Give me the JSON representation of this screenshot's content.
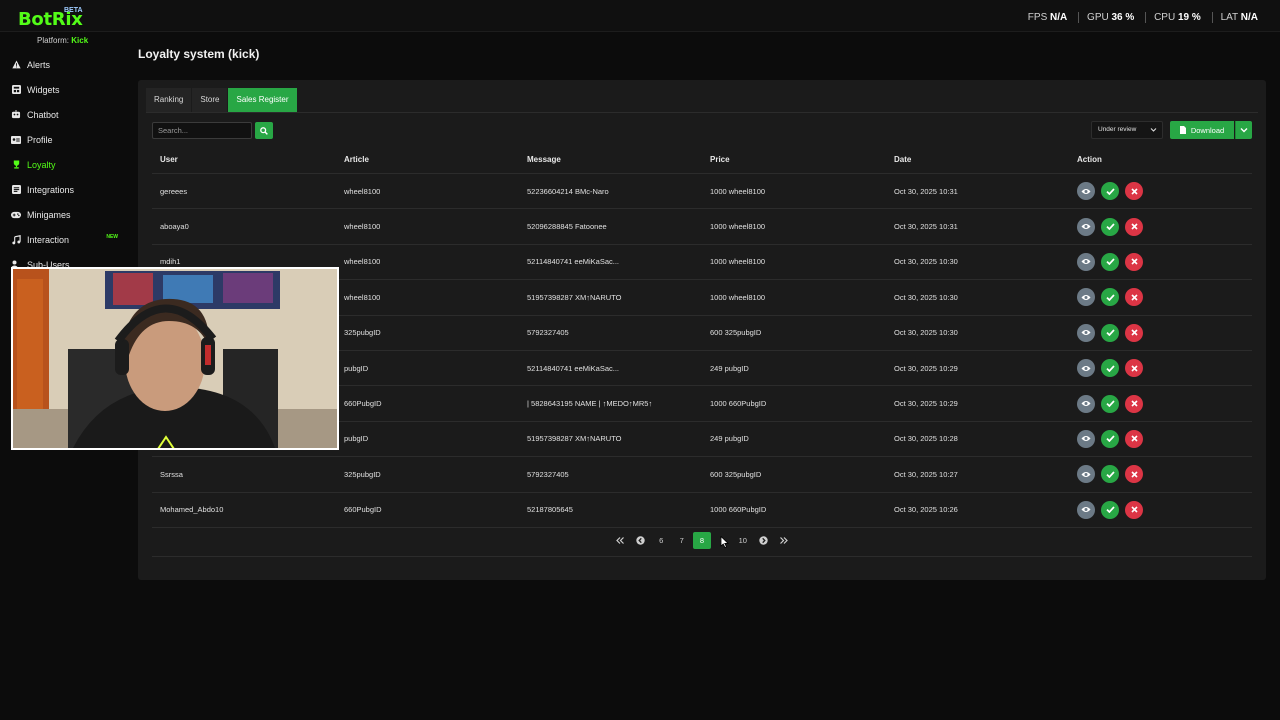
{
  "app": {
    "logo": "BotRix",
    "logo_badge": "BETA"
  },
  "stats": [
    {
      "label": "FPS",
      "value": "N/A"
    },
    {
      "label": "GPU",
      "value": "36 %"
    },
    {
      "label": "CPU",
      "value": "19 %"
    },
    {
      "label": "LAT",
      "value": "N/A"
    }
  ],
  "platform": {
    "label": "Platform:",
    "value": "Kick"
  },
  "sidebar": {
    "items": [
      {
        "label": "Alerts",
        "icon": "alert-triangle-icon"
      },
      {
        "label": "Widgets",
        "icon": "widgets-icon"
      },
      {
        "label": "Chatbot",
        "icon": "robot-icon"
      },
      {
        "label": "Profile",
        "icon": "id-card-icon"
      },
      {
        "label": "Loyalty",
        "icon": "trophy-icon",
        "active": true
      },
      {
        "label": "Integrations",
        "icon": "integrations-icon"
      },
      {
        "label": "Minigames",
        "icon": "gamepad-icon"
      },
      {
        "label": "Interaction",
        "icon": "music-icon",
        "badge": "NEW"
      },
      {
        "label": "Sub-Users",
        "icon": "users-icon"
      }
    ]
  },
  "page_title": "Loyalty system (kick)",
  "tabs": [
    {
      "label": "Ranking"
    },
    {
      "label": "Store"
    },
    {
      "label": "Sales Register",
      "active": true
    }
  ],
  "search": {
    "placeholder": "Search..."
  },
  "filter": {
    "selected": "Under review"
  },
  "download": {
    "label": "Download"
  },
  "table": {
    "columns": [
      "User",
      "Article",
      "Message",
      "Price",
      "Date",
      "Action"
    ],
    "rows": [
      {
        "user": "gereees",
        "article": "wheel8100",
        "message": "52236604214 BMc-Naro",
        "price": "1000 wheel8100",
        "date": "Oct 30, 2025 10:31"
      },
      {
        "user": "aboaya0",
        "article": "wheel8100",
        "message": "52096288845 Fatoonee",
        "price": "1000 wheel8100",
        "date": "Oct 30, 2025 10:31"
      },
      {
        "user": "mdih1",
        "article": "wheel8100",
        "message": "52114840741 eeMiKaSac...",
        "price": "1000 wheel8100",
        "date": "Oct 30, 2025 10:30"
      },
      {
        "user": "",
        "article": "wheel8100",
        "message": "51957398287 XM↑NARUTO",
        "price": "1000 wheel8100",
        "date": "Oct 30, 2025 10:30"
      },
      {
        "user": "",
        "article": "325pubgID",
        "message": "5792327405",
        "price": "600 325pubgID",
        "date": "Oct 30, 2025 10:30"
      },
      {
        "user": "",
        "article": "pubgID",
        "message": "52114840741 eeMiKaSac...",
        "price": "249 pubgID",
        "date": "Oct 30, 2025 10:29"
      },
      {
        "user": "",
        "article": "660PubgID",
        "message": "| 5828643195 NAME | ↑MEDO↑MR5↑",
        "price": "1000 660PubgID",
        "date": "Oct 30, 2025 10:29"
      },
      {
        "user": "",
        "article": "pubgID",
        "message": "51957398287 XM↑NARUTO",
        "price": "249 pubgID",
        "date": "Oct 30, 2025 10:28"
      },
      {
        "user": "Ssrssa",
        "article": "325pubgID",
        "message": "5792327405",
        "price": "600 325pubgID",
        "date": "Oct 30, 2025 10:27"
      },
      {
        "user": "Mohamed_Abdo10",
        "article": "660PubgID",
        "message": "52187805645",
        "price": "1000 660PubgID",
        "date": "Oct 30, 2025 10:26"
      }
    ]
  },
  "pagination": {
    "pages": [
      "6",
      "7",
      "8",
      "9",
      "10"
    ],
    "current": "8"
  },
  "colors": {
    "accent": "#28a745",
    "brand": "#53fc18",
    "danger": "#dc3545",
    "muted": "#6c7a86"
  }
}
